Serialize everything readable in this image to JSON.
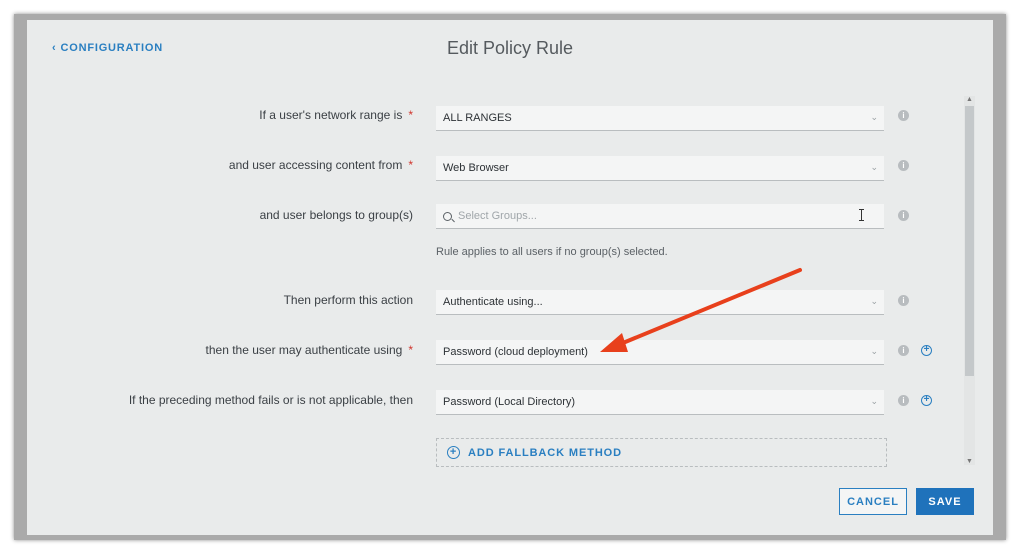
{
  "header": {
    "back_label": "CONFIGURATION",
    "title": "Edit Policy Rule"
  },
  "rows": [
    {
      "label": "If a user's network range is",
      "required": "*",
      "value": "ALL RANGES"
    },
    {
      "label": "and user accessing content from",
      "required": "*",
      "value": "Web Browser"
    },
    {
      "label": "and user belongs to group(s)",
      "placeholder": "Select Groups..."
    },
    {
      "label": "Then perform this action",
      "value": "Authenticate using..."
    },
    {
      "label": "then the user may authenticate using",
      "required": "*",
      "value": "Password (cloud deployment)"
    },
    {
      "label": "If the preceding method fails or is not applicable, then",
      "value": "Password (Local Directory)"
    }
  ],
  "helper_text": "Rule applies to all users if no group(s) selected.",
  "fallback_label": "ADD FALLBACK METHOD",
  "buttons": {
    "cancel": "CANCEL",
    "save": "SAVE"
  },
  "icons": {
    "info": "i",
    "plus": "+",
    "caret": "⌄",
    "back": "‹"
  },
  "colors": {
    "accent": "#2a7fc1",
    "required": "#d0342c",
    "annotation_arrow": "#e8401c"
  }
}
